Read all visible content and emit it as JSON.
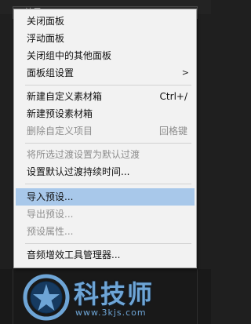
{
  "background": {
    "field_text": "效果"
  },
  "menu": {
    "items": [
      {
        "label": "关闭面板",
        "shortcut": "",
        "disabled": false,
        "highlighted": false,
        "submenu": false
      },
      {
        "label": "浮动面板",
        "shortcut": "",
        "disabled": false,
        "highlighted": false,
        "submenu": false
      },
      {
        "label": "关闭组中的其他面板",
        "shortcut": "",
        "disabled": false,
        "highlighted": false,
        "submenu": false
      },
      {
        "label": "面板组设置",
        "shortcut": "",
        "disabled": false,
        "highlighted": false,
        "submenu": true
      },
      {
        "label": "新建自定义素材箱",
        "shortcut": "Ctrl+/",
        "disabled": false,
        "highlighted": false,
        "submenu": false
      },
      {
        "label": "新建预设素材箱",
        "shortcut": "",
        "disabled": false,
        "highlighted": false,
        "submenu": false
      },
      {
        "label": "删除自定义项目",
        "shortcut": "回格键",
        "disabled": true,
        "highlighted": false,
        "submenu": false
      },
      {
        "label": "将所选过渡设置为默认过渡",
        "shortcut": "",
        "disabled": true,
        "highlighted": false,
        "submenu": false
      },
      {
        "label": "设置默认过渡持续时间...",
        "shortcut": "",
        "disabled": false,
        "highlighted": false,
        "submenu": false
      },
      {
        "label": "导入预设...",
        "shortcut": "",
        "disabled": false,
        "highlighted": true,
        "submenu": false
      },
      {
        "label": "导出预设...",
        "shortcut": "",
        "disabled": true,
        "highlighted": false,
        "submenu": false
      },
      {
        "label": "预设属性...",
        "shortcut": "",
        "disabled": true,
        "highlighted": false,
        "submenu": false
      },
      {
        "label": "音频增效工具管理器...",
        "shortcut": "",
        "disabled": false,
        "highlighted": false,
        "submenu": false
      }
    ],
    "submenu_arrow": ">"
  },
  "watermark": {
    "brand": "科技师",
    "url": "www.3kjs.com"
  },
  "colors": {
    "menu_bg": "#f2f2f2",
    "highlight": "#a8c8ea",
    "disabled_text": "#8e8e8e",
    "watermark": "#6ea5d6"
  }
}
